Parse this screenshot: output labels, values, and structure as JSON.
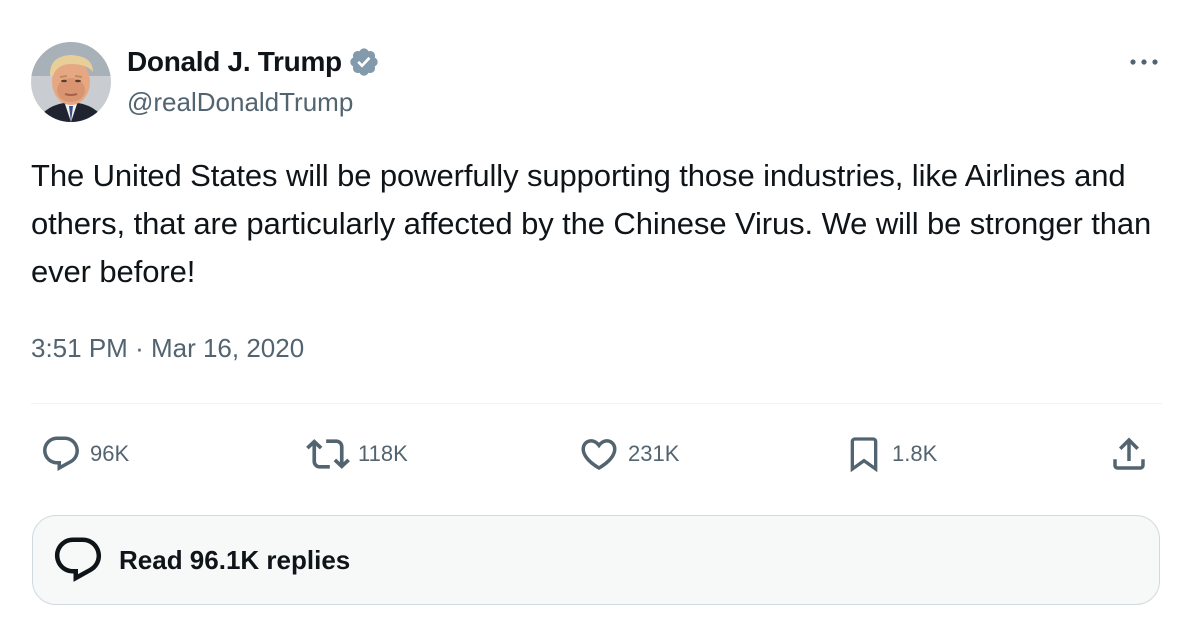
{
  "author": {
    "display_name": "Donald J. Trump",
    "handle": "@realDonaldTrump",
    "verified": true,
    "verified_color": "#829aab"
  },
  "tweet": {
    "text": "The United States will be powerfully supporting those industries, like Airlines and others, that are particularly affected by the Chinese Virus. We will be stronger than ever before!",
    "time": "3:51 PM",
    "separator": "·",
    "date": "Mar 16, 2020"
  },
  "actions": {
    "reply": {
      "icon": "reply-bubble-icon",
      "count": "96K"
    },
    "retweet": {
      "icon": "retweet-icon",
      "count": "118K"
    },
    "like": {
      "icon": "heart-icon",
      "count": "231K"
    },
    "bookmark": {
      "icon": "bookmark-icon",
      "count": "1.8K"
    },
    "share": {
      "icon": "share-upload-icon"
    }
  },
  "replies_button": {
    "label": "Read 96.1K replies",
    "icon": "replies-bubble-icon"
  },
  "menu": {
    "icon": "more-dots-icon"
  }
}
